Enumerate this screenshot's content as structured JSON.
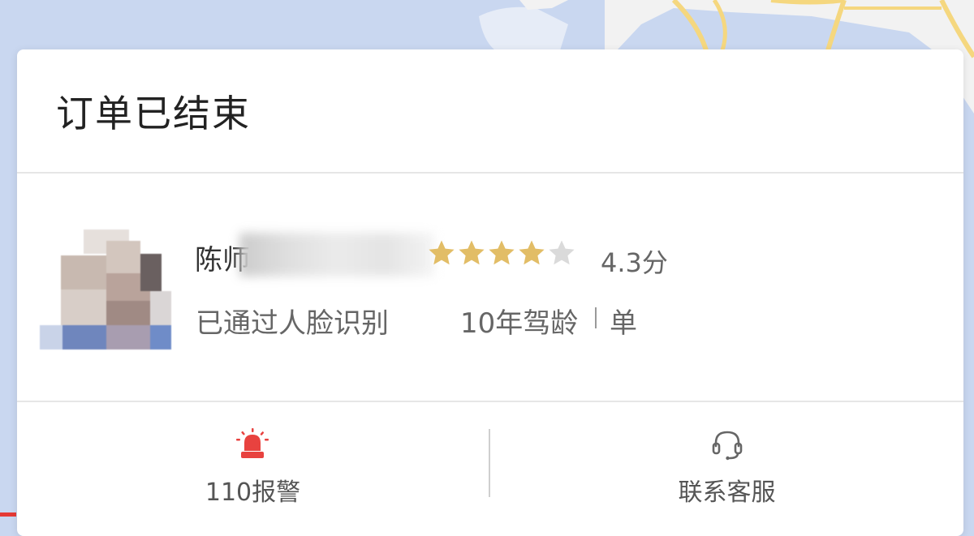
{
  "order": {
    "title": "订单已结束"
  },
  "driver": {
    "name_visible": "陈师",
    "rating_value": 4.3,
    "rating_max": 5,
    "rating_text": "4.3分",
    "face_check": "已通过人脸识别",
    "experience": "10年驾龄",
    "orders": "单"
  },
  "actions": {
    "police_label": "110报警",
    "service_label": "联系客服"
  },
  "colors": {
    "star_filled": "#e2bd66",
    "star_empty": "#dadada",
    "alarm_red": "#e8423f",
    "map_water": "#c9d7f0",
    "map_road": "#f5d77f"
  }
}
